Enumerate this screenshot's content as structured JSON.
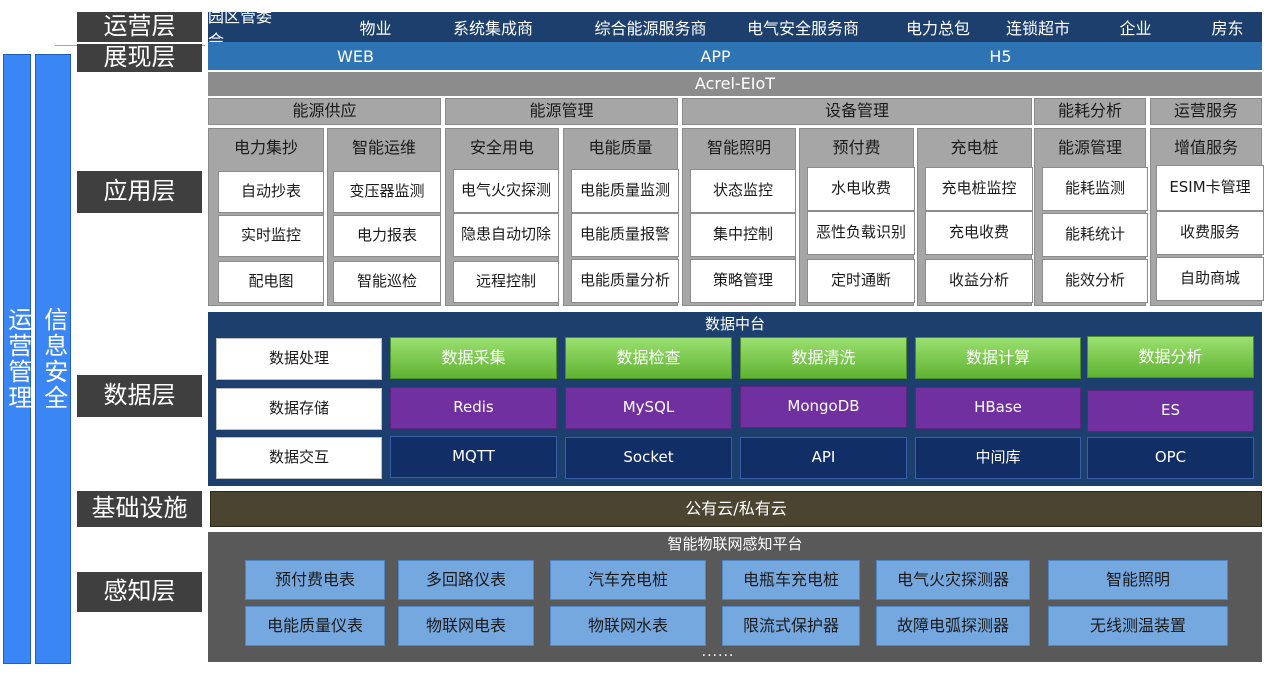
{
  "side": {
    "ops_mgmt": "运营管理",
    "info_sec": "信息安全"
  },
  "layers": {
    "ops": "运营层",
    "show": "展现层",
    "app": "应用层",
    "data": "数据层",
    "infra": "基础设施",
    "perc": "感知层"
  },
  "ops_items": [
    "园区管委会",
    "物业",
    "系统集成商",
    "综合能源服务商",
    "电气安全服务商",
    "电力总包",
    "连锁超市",
    "企业",
    "房东"
  ],
  "show_items": [
    "WEB",
    "APP",
    "H5"
  ],
  "platform": "Acrel-EIoT",
  "app": {
    "categories": [
      "能源供应",
      "能源管理",
      "设备管理",
      "能耗分析",
      "运营服务"
    ],
    "columns": [
      {
        "title": "电力集抄",
        "items": [
          "自动抄表",
          "实时监控",
          "配电图"
        ]
      },
      {
        "title": "智能运维",
        "items": [
          "变压器监测",
          "电力报表",
          "智能巡检"
        ]
      },
      {
        "title": "安全用电",
        "items": [
          "电气火灾探测",
          "隐患自动切除",
          "远程控制"
        ]
      },
      {
        "title": "电能质量",
        "items": [
          "电能质量监测",
          "电能质量报警",
          "电能质量分析"
        ]
      },
      {
        "title": "智能照明",
        "items": [
          "状态监控",
          "集中控制",
          "策略管理"
        ]
      },
      {
        "title": "预付费",
        "items": [
          "水电收费",
          "恶性负载识别",
          "定时通断"
        ]
      },
      {
        "title": "充电桩",
        "items": [
          "充电桩监控",
          "充电收费",
          "收益分析"
        ]
      },
      {
        "title": "能源管理",
        "items": [
          "能耗监测",
          "能耗统计",
          "能效分析"
        ]
      },
      {
        "title": "增值服务",
        "items": [
          "ESIM卡管理",
          "收费服务",
          "自助商城"
        ]
      }
    ]
  },
  "data": {
    "title": "数据中台",
    "labels": [
      "数据处理",
      "数据存储",
      "数据交互"
    ],
    "green": [
      "数据采集",
      "数据检查",
      "数据清洗",
      "数据计算",
      "数据分析"
    ],
    "purple": [
      "Redis",
      "MySQL",
      "MongoDB",
      "HBase",
      "ES"
    ],
    "navy": [
      "MQTT",
      "Socket",
      "API",
      "中间库",
      "OPC"
    ]
  },
  "infra": {
    "cloud": "公有云/私有云"
  },
  "perc": {
    "title": "智能物联网感知平台",
    "row1": [
      "预付费电表",
      "多回路仪表",
      "汽车充电桩",
      "电瓶车充电桩",
      "电气火灾探测器",
      "智能照明"
    ],
    "row2": [
      "电能质量仪表",
      "物联网电表",
      "物联网水表",
      "限流式保护器",
      "故障电弧探测器",
      "无线测温装置"
    ],
    "more": "......"
  }
}
